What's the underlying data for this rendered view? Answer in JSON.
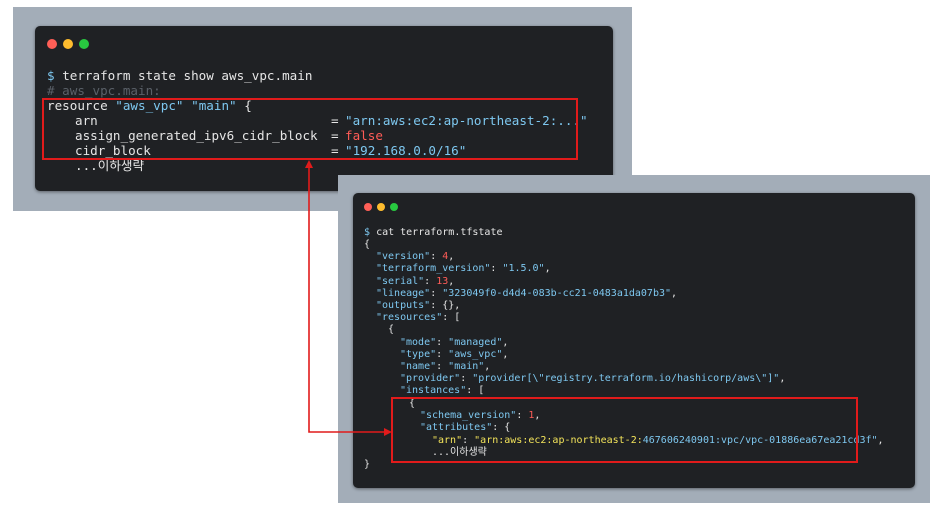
{
  "terminal_top": {
    "prompt": "$",
    "command": "terraform state show aws_vpc.main",
    "comment": "# aws_vpc.main:",
    "resource_kw": "resource",
    "resource_type": "\"aws_vpc\"",
    "resource_name": "\"main\"",
    "open_brace": "{",
    "rows": [
      {
        "key": "arn",
        "eq": "=",
        "value": "\"arn:aws:ec2:ap-northeast-2:...\""
      },
      {
        "key": "assign_generated_ipv6_cidr_block",
        "eq": "=",
        "value": "false"
      },
      {
        "key": "cidr_block",
        "eq": "=",
        "value": "\"192.168.0.0/16\""
      }
    ],
    "ellipsis": "...이하생략"
  },
  "terminal_bottom": {
    "prompt": "$",
    "command": "cat terraform.tfstate",
    "lines": {
      "l01": "{",
      "version_key": "\"version\"",
      "version_val": "4",
      "tfver_key": "\"terraform_version\"",
      "tfver_val": "\"1.5.0\"",
      "serial_key": "\"serial\"",
      "serial_val": "13",
      "lineage_key": "\"lineage\"",
      "lineage_val": "\"323049f0-d4d4-083b-cc21-0483a1da07b3\"",
      "outputs_key": "\"outputs\"",
      "outputs_val": "{}",
      "resources_key": "\"resources\"",
      "resources_val": "[",
      "obj_open": "{",
      "mode_key": "\"mode\"",
      "mode_val": "\"managed\"",
      "type_key": "\"type\"",
      "type_val": "\"aws_vpc\"",
      "name_key": "\"name\"",
      "name_val": "\"main\"",
      "provider_key": "\"provider\"",
      "provider_val": "\"provider[\\\"registry.terraform.io/hashicorp/aws\\\"]\"",
      "instances_key": "\"instances\"",
      "instances_val": "[",
      "inst_open": "{",
      "schema_key": "\"schema_version\"",
      "schema_val": "1",
      "attributes_key": "\"attributes\"",
      "attributes_val": "{",
      "arn_key": "\"arn\"",
      "arn_val_a": "\"arn:aws:ec2:ap-northeast-2:",
      "arn_val_b": "467606240901:vpc/vpc-01886ea67ea21cd3f\"",
      "ellipsis": "...이하생략",
      "close": "}"
    }
  },
  "colors": {
    "window_bg": "#1f2124",
    "frame_bg": "#a3adb8",
    "highlight": "#e11b1b",
    "dot_red": "#ff5f57",
    "dot_yellow": "#febc2e",
    "dot_green": "#28c840"
  }
}
